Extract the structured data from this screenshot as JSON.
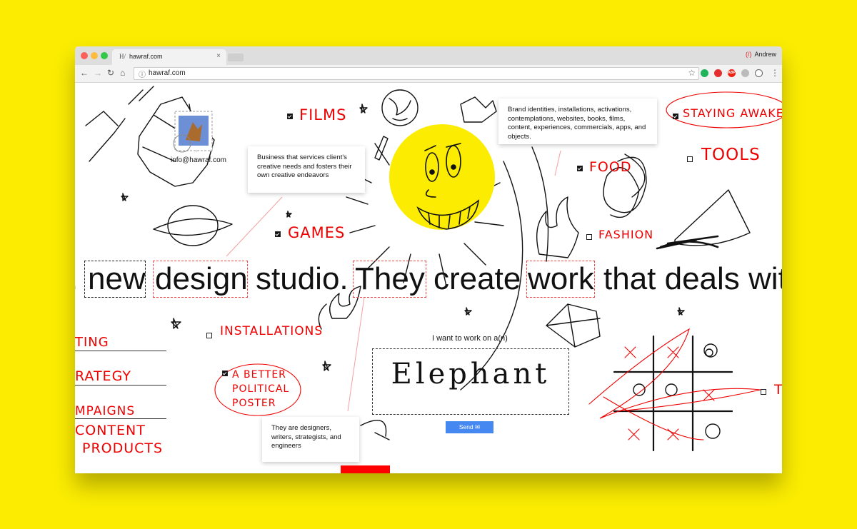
{
  "browser": {
    "tab_title": "hawraf.com",
    "tab_favicon": "H/",
    "tab_close": "×",
    "profile_name": "Andrew",
    "profile_icon": "(/)",
    "nav_back": "←",
    "nav_forward": "→",
    "nav_reload": "↻",
    "nav_home": "⌂",
    "url": "hawraf.com",
    "info_icon": "ⓘ",
    "star_icon": "☆",
    "menu_icon": "⋮",
    "extensions": [
      "ext-green-icon",
      "ext-opera-icon",
      "ext-abp-icon",
      "ext-cloud-icon",
      "ext-info-icon"
    ]
  },
  "page": {
    "email": "info@hawraf.com",
    "cards": {
      "services": "Business that services client's creative needs and fosters their own creative endeavors",
      "work": "Brand identities, installations, activations, contemplations, websites, books, films, content, experiences, commercials, apps, and objects.",
      "people": "They are designers, writers, strategists, and engineers"
    },
    "labels": {
      "films": "FILMS",
      "staying_awake": "STAYING AWAKE",
      "tools": "TOOLS",
      "food": "FOOD",
      "games": "GAMES",
      "fashion": "FASHION",
      "installations": "INSTALLATIONS",
      "political": [
        "A BETTER",
        "POLITICAL",
        "POSTER"
      ],
      "partial_t": "T"
    },
    "menu": [
      "TING",
      "RATEGY",
      "MPAIGNS",
      "CONTENT",
      "PRODUCTS"
    ],
    "headline": {
      "prefix": ". ",
      "new": "new",
      "design": "design",
      "studio": "studio.",
      "they": "They",
      "create": "create",
      "work": "work",
      "tail": "that deals with"
    },
    "form": {
      "label": "I want to work on a(n)",
      "value": "Elephant",
      "send": "Send"
    },
    "colors": {
      "red": "#ee0000",
      "yellow": "#fbec02",
      "blue": "#4688f1"
    }
  }
}
